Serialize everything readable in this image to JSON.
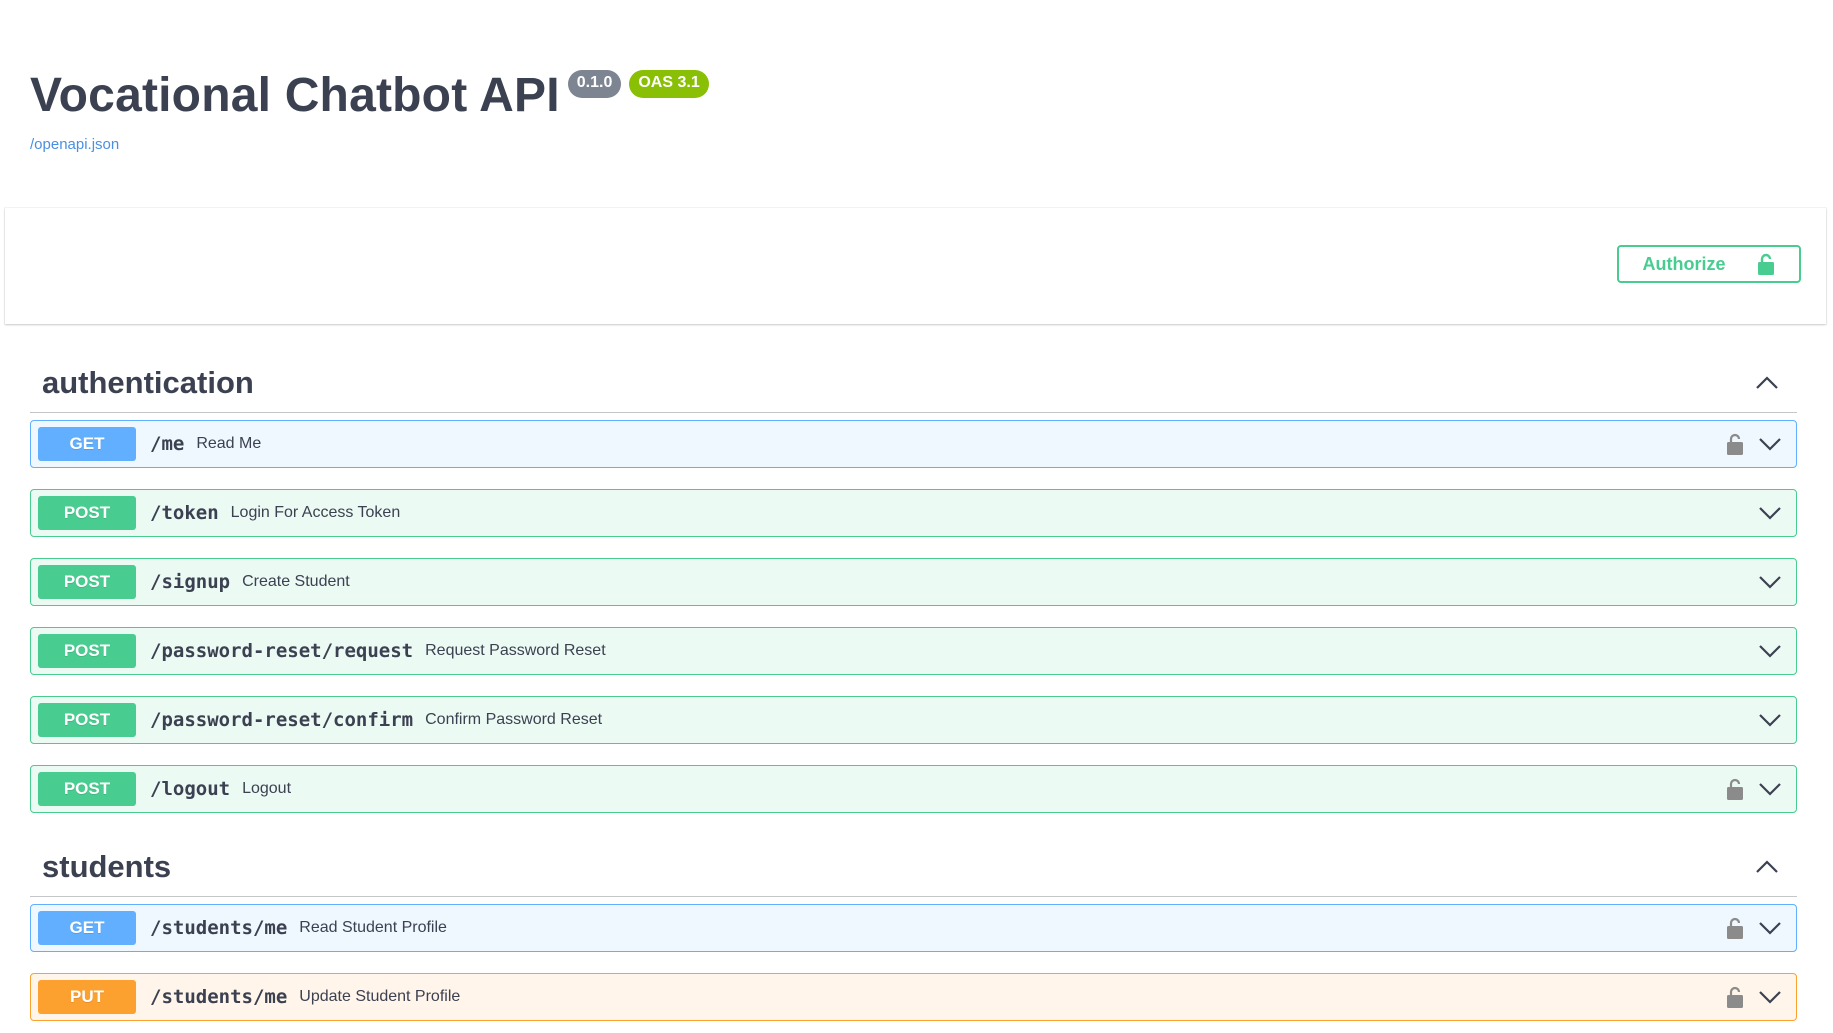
{
  "info": {
    "title": "Vocational Chatbot API",
    "version": "0.1.0",
    "oas": "OAS 3.1",
    "spec_link": "/openapi.json"
  },
  "authorize": {
    "label": "Authorize",
    "icon": "unlocked-lock-icon"
  },
  "colors": {
    "get": "#61affe",
    "post": "#49cc90",
    "put": "#fca130",
    "version_badge": "#7d8492",
    "oas_badge": "#89bf04",
    "link": "#4990e2"
  },
  "sections": [
    {
      "name": "authentication",
      "expanded": true,
      "operations": [
        {
          "method": "GET",
          "path": "/me",
          "summary": "Read Me",
          "locked": true
        },
        {
          "method": "POST",
          "path": "/token",
          "summary": "Login For Access Token",
          "locked": false
        },
        {
          "method": "POST",
          "path": "/signup",
          "summary": "Create Student",
          "locked": false
        },
        {
          "method": "POST",
          "path": "/password-reset/request",
          "summary": "Request Password Reset",
          "locked": false
        },
        {
          "method": "POST",
          "path": "/password-reset/confirm",
          "summary": "Confirm Password Reset",
          "locked": false
        },
        {
          "method": "POST",
          "path": "/logout",
          "summary": "Logout",
          "locked": true
        }
      ]
    },
    {
      "name": "students",
      "expanded": true,
      "operations": [
        {
          "method": "GET",
          "path": "/students/me",
          "summary": "Read Student Profile",
          "locked": true
        },
        {
          "method": "PUT",
          "path": "/students/me",
          "summary": "Update Student Profile",
          "locked": true
        }
      ]
    }
  ]
}
